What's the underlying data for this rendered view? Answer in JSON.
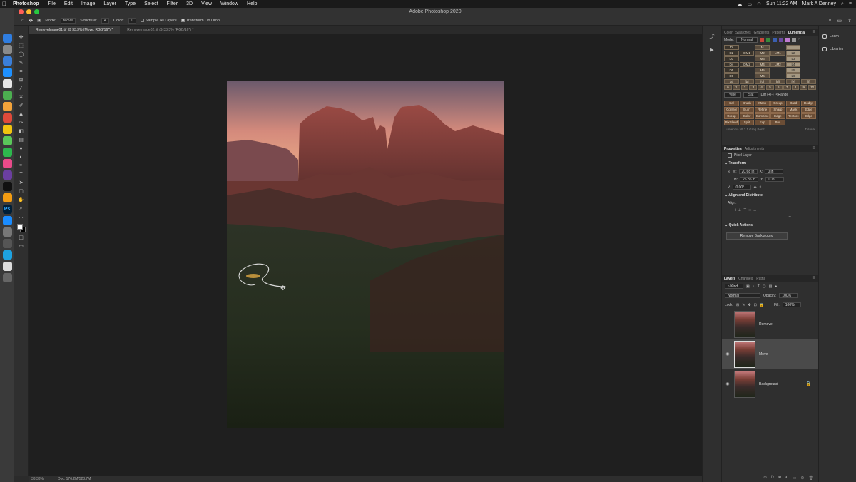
{
  "menubar": {
    "app": "Photoshop",
    "items": [
      "File",
      "Edit",
      "Image",
      "Layer",
      "Type",
      "Select",
      "Filter",
      "3D",
      "View",
      "Window",
      "Help"
    ],
    "datetime": "Sun 11:22 AM",
    "user": "Mark A Denney"
  },
  "window": {
    "title": "Adobe Photoshop 2020"
  },
  "options": {
    "mode_label": "Mode:",
    "mode_value": "Move",
    "structure_label": "Structure:",
    "structure_value": "4",
    "color_label": "Color:",
    "color_value": "0",
    "sample_all": "Sample All Layers",
    "transform_drop": "Transform On Drop"
  },
  "tabs": [
    {
      "label": "RemoveImage01.tif @ 33.3% (Move, RGB/16*) *"
    },
    {
      "label": "RemoveImage02.tif @ 33.3% (RGB/16*) *"
    }
  ],
  "status": {
    "zoom": "33.33%",
    "doc": "Doc: 176.2M/528.7M"
  },
  "lumenzia": {
    "tabs": [
      "Color",
      "Swatches",
      "Gradients",
      "Patterns",
      "Lumenzia"
    ],
    "mode_label": "Mode:",
    "mode_value": "Normal",
    "swatches": [
      "#c8463a",
      "#3a8a3a",
      "#3a5fb0",
      "#6a4aa0",
      "#c07ad0",
      "#9a9a9a"
    ],
    "grid_rows": [
      [
        "D",
        "",
        "M",
        "",
        "L",
        ""
      ],
      [
        "D2",
        "DM1",
        "M2",
        "LM1",
        "L2",
        ""
      ],
      [
        "D3",
        "",
        "M3",
        "",
        "L3",
        ""
      ],
      [
        "D4",
        "DM2",
        "M4",
        "LM2",
        "L4",
        ""
      ],
      [
        "D5",
        "",
        "M5",
        "",
        "L5",
        ""
      ],
      [
        "D6",
        "",
        "M6",
        "",
        "L6",
        ""
      ]
    ],
    "zone_row": [
      "[a]",
      "[b]",
      "[c]",
      "[d]",
      "[e]",
      "[f]"
    ],
    "num_row": [
      "0",
      "1",
      "2",
      "3",
      "4",
      "5",
      "6",
      "7",
      "8",
      "9",
      "10"
    ],
    "vibe_row": [
      "Vibe",
      "Sat",
      "Diff (+/-)",
      "<Range"
    ],
    "buttons": [
      "Sel",
      "Brush",
      "Mask",
      "Group",
      "Grad",
      "Dodge",
      "Control",
      "Burn",
      "Refine",
      "Sharp",
      "Mask",
      "Edge",
      "Group",
      "Color",
      "Combine",
      "Edge",
      "Restore",
      "Edge",
      "PixBlend",
      "Split",
      "Exp",
      "Bus"
    ],
    "version": "Lumenzia v9.3.1 Greg Benz",
    "tutorial": "Tutorial"
  },
  "properties": {
    "tabs": [
      "Properties",
      "Adjustments"
    ],
    "layer_type": "Pixel Layer",
    "transform_title": "Transform",
    "w": "20.68 in",
    "h": "25.85 in",
    "x": "0 in",
    "y": "0 in",
    "angle": "0.00°",
    "align_title": "Align and Distribute",
    "align_label": "Align:",
    "quick_title": "Quick Actions",
    "remove_bg": "Remove Background"
  },
  "layers_panel": {
    "tabs": [
      "Layers",
      "Channels",
      "Paths"
    ],
    "kind": "Kind",
    "blend": "Normal",
    "opacity_label": "Opacity:",
    "opacity": "100%",
    "lock_label": "Lock:",
    "fill_label": "Fill:",
    "fill": "100%",
    "layers": [
      {
        "name": "Remove",
        "visible": false,
        "selected": false,
        "locked": false
      },
      {
        "name": "Move",
        "visible": true,
        "selected": true,
        "locked": false
      },
      {
        "name": "Background",
        "visible": true,
        "selected": false,
        "locked": true
      }
    ]
  },
  "libpanel": {
    "learn": "Learn",
    "libraries": "Libraries"
  }
}
